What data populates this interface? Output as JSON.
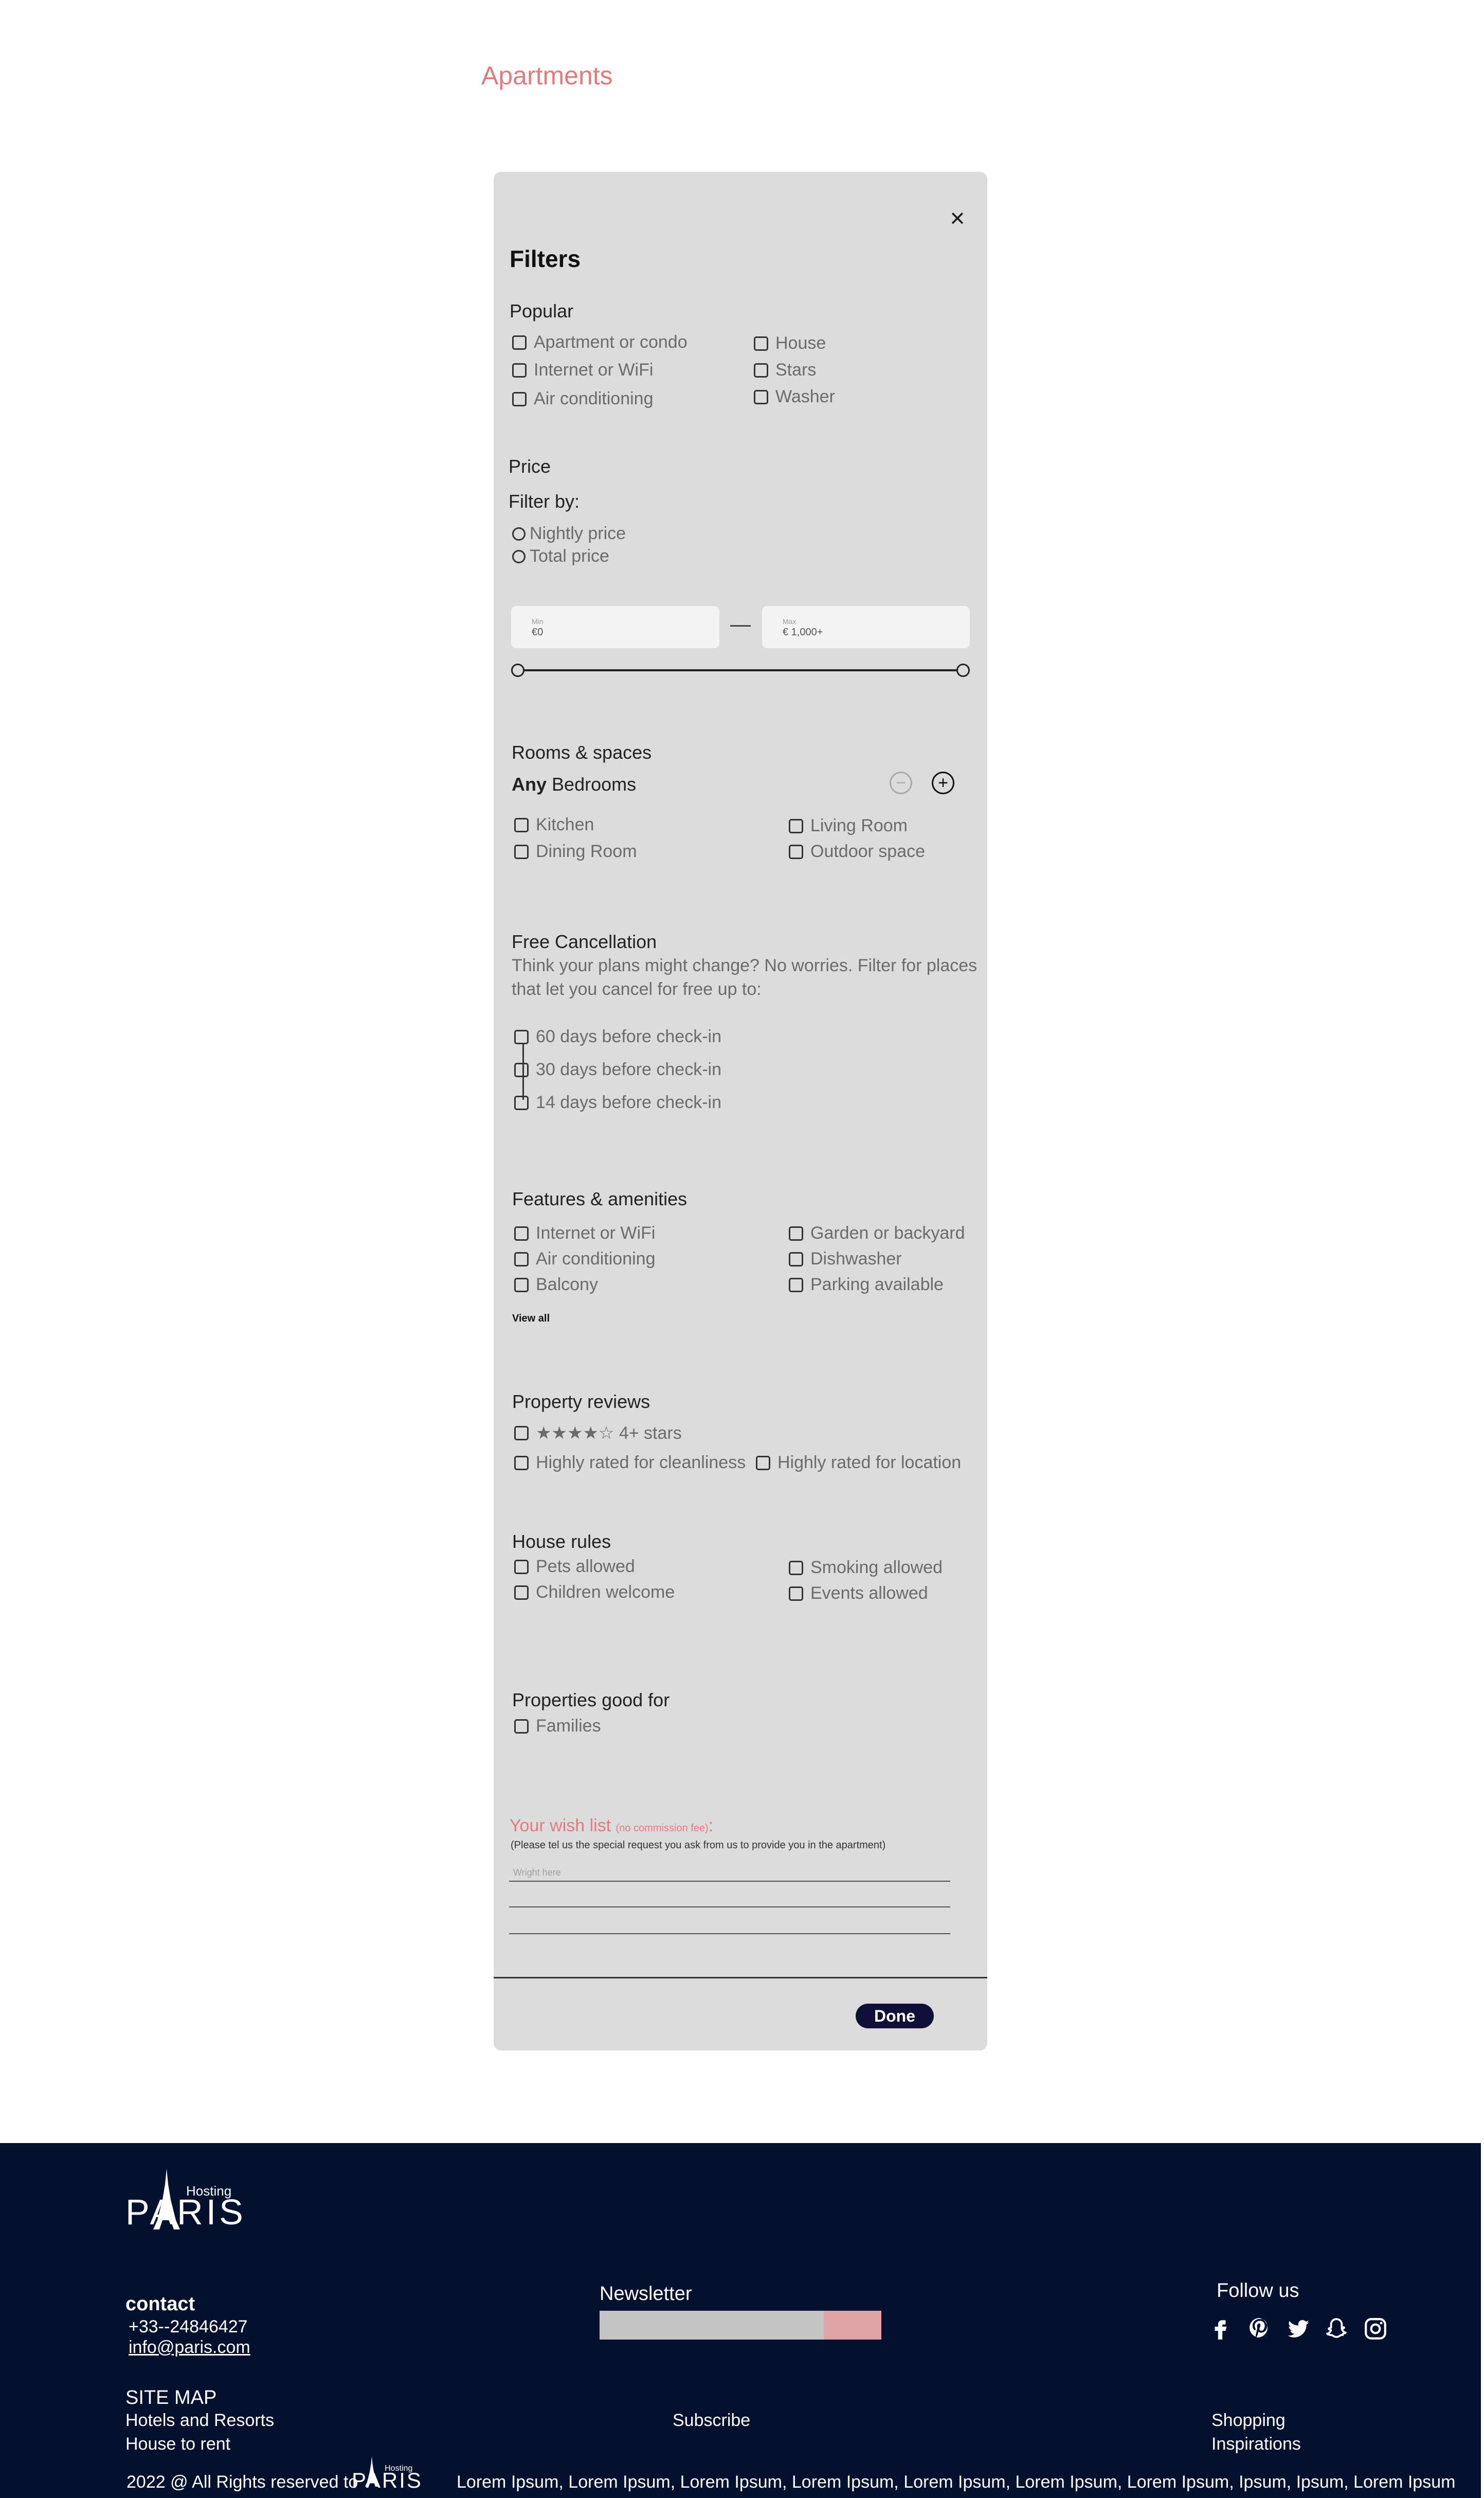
{
  "page": {
    "title": "Apartments"
  },
  "filters": {
    "title": "Filters",
    "close_icon": "close-icon",
    "popular": {
      "heading": "Popular",
      "col1": [
        "Apartment or condo",
        "Internet or WiFi",
        "Air conditioning"
      ],
      "col2": [
        "House",
        "Stars",
        "Washer"
      ]
    },
    "price": {
      "heading": "Price",
      "filter_by": "Filter by:",
      "options": [
        "Nightly price",
        "Total price"
      ],
      "min_label": "Min",
      "min_value": "€0",
      "max_label": "Max",
      "max_value": "€ 1,000+",
      "dash": "—"
    },
    "rooms": {
      "heading": "Rooms & spaces",
      "bedrooms_prefix": "Any",
      "bedrooms_label": "Bedrooms",
      "col1": [
        "Kitchen",
        "Dining Room"
      ],
      "col2": [
        "Living Room",
        "Outdoor space"
      ]
    },
    "cancellation": {
      "heading": "Free Cancellation",
      "desc_line1": "Think your plans might change? No worries. Filter for places",
      "desc_line2": "that let you cancel for free up to:",
      "options": [
        "60 days before check-in",
        "30 days before check-in",
        "14 days before check-in"
      ]
    },
    "features": {
      "heading": "Features & amenities",
      "col1": [
        "Internet or WiFi",
        "Air conditioning",
        "Balcony"
      ],
      "col2": [
        "Garden or backyard",
        "Dishwasher",
        "Parking available"
      ],
      "view_all": "View all"
    },
    "reviews": {
      "heading": "Property reviews",
      "stars_option": "★★★★☆ 4+ stars",
      "cleanliness": "Highly rated for cleanliness",
      "location": "Highly rated for location"
    },
    "house_rules": {
      "heading": "House rules",
      "col1": [
        "Pets allowed",
        "Children welcome"
      ],
      "col2": [
        "Smoking allowed",
        "Events allowed"
      ]
    },
    "good_for": {
      "heading": "Properties good for",
      "options": [
        "Families"
      ]
    },
    "wish_list": {
      "title": "Your wish list",
      "note": "(no commission fee)",
      "colon": ":",
      "desc": "(Please tel us the special request you ask from us to provide you in the apartment)",
      "placeholder": "Wright here"
    },
    "done_label": "Done"
  },
  "footer": {
    "logo_text": "PARIS",
    "logo_sub": "Hosting",
    "contact_heading": "contact",
    "phone": "+33--24846427",
    "email": "info@paris.com",
    "newsletter_heading": "Newsletter",
    "subscribe_label": "Subscribe",
    "follow_heading": "Follow us",
    "social_icons": [
      "facebook-icon",
      "pinterest-icon",
      "twitter-icon",
      "snapchat-icon",
      "instagram-icon"
    ],
    "sitemap_heading": "SITE MAP",
    "sitemap_col1": [
      "Hotels and Resorts",
      "House to rent"
    ],
    "sitemap_col2": [
      "Shopping",
      "Inspirations"
    ],
    "copyright": "2022 @ All Rights reserved to",
    "lorem": "Lorem Ipsum, Lorem Ipsum, Lorem Ipsum, Lorem Ipsum, Lorem Ipsum, Lorem Ipsum, Lorem Ipsum, Ipsum, Ipsum, Lorem Ipsum",
    "colors": {
      "background": "#03102e",
      "accent": "#e0a4a6"
    }
  }
}
